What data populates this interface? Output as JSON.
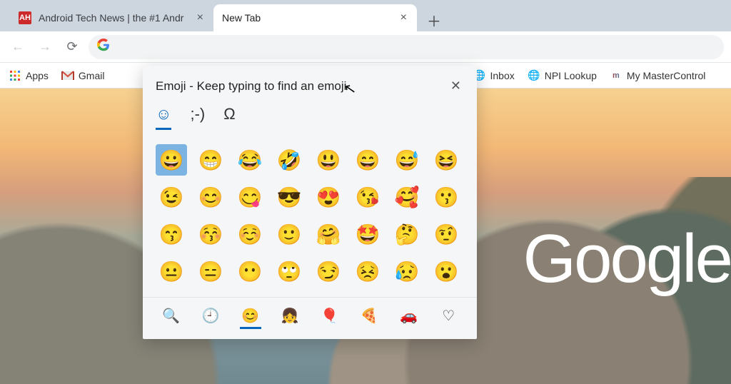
{
  "tabs": {
    "inactive": {
      "title": "Android Tech News | the #1 Andr",
      "favicon_text": "AH",
      "favicon_bg": "#cc2a2a"
    },
    "active": {
      "title": "New Tab"
    }
  },
  "omnibox": {
    "value": "",
    "placeholder": ""
  },
  "bookmarks": [
    {
      "name": "apps",
      "label": "Apps",
      "icon": "grid"
    },
    {
      "name": "gmail",
      "label": "Gmail",
      "icon": "gmail"
    },
    {
      "name": "inbox",
      "label": "Inbox",
      "icon": "globe"
    },
    {
      "name": "npi-lookup",
      "label": "NPI Lookup",
      "icon": "globe"
    },
    {
      "name": "mastercontrol",
      "label": "My MasterControl",
      "icon": "mc"
    }
  ],
  "emoji_picker": {
    "title": "Emoji - Keep typing to find an emoji",
    "top_tabs": [
      {
        "name": "emoji-tab",
        "glyph": "☺",
        "active": true
      },
      {
        "name": "kaomoji-tab",
        "glyph": ";-)",
        "active": false
      },
      {
        "name": "symbols-tab",
        "glyph": "Ω",
        "active": false
      }
    ],
    "grid": [
      "😀",
      "😁",
      "😂",
      "🤣",
      "😃",
      "😄",
      "😅",
      "😆",
      "😉",
      "😊",
      "😋",
      "😎",
      "😍",
      "😘",
      "🥰",
      "😗",
      "😙",
      "😚",
      "☺️",
      "🙂",
      "🤗",
      "🤩",
      "🤔",
      "🤨",
      "😐",
      "😑",
      "😶",
      "🙄",
      "😏",
      "😣",
      "😥",
      "😮"
    ],
    "selected_index": 0,
    "categories": [
      {
        "name": "search-cat",
        "glyph": "🔍"
      },
      {
        "name": "recent-cat",
        "glyph": "🕘"
      },
      {
        "name": "smileys-cat",
        "glyph": "😊",
        "active": true
      },
      {
        "name": "people-cat",
        "glyph": "👧"
      },
      {
        "name": "events-cat",
        "glyph": "🎈"
      },
      {
        "name": "food-cat",
        "glyph": "🍕"
      },
      {
        "name": "travel-cat",
        "glyph": "🚗"
      },
      {
        "name": "symbols-cat",
        "glyph": "♡"
      }
    ]
  },
  "page": {
    "logo_text": "Google"
  }
}
